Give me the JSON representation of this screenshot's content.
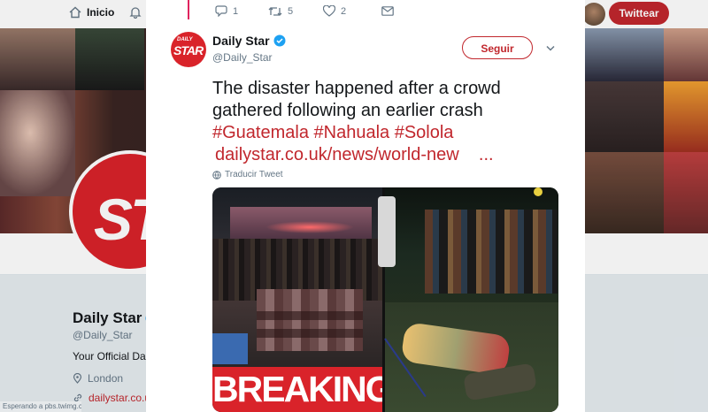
{
  "topbar": {
    "home_label": "Inicio",
    "tweet_button_label": "Twittear"
  },
  "profile": {
    "logo_text": "STAR",
    "name": "Daily Star",
    "handle": "@Daily_Star",
    "bio": "Your Official Daily",
    "location": "London",
    "url": "dailystar.co.uk"
  },
  "status_bar_text": "Esperando a pbs.twimg.com...",
  "tweet": {
    "author_name": "Daily Star",
    "author_handle": "@Daily_Star",
    "avatar_text_top": "DAILY",
    "avatar_text_bottom": "STAR",
    "follow_label": "Seguir",
    "text": "The disaster happened after a crowd gathered following an earlier crash",
    "hashtags": "#Guatemala #Nahuala #Solola",
    "link": "dailystar.co.uk/news/world-new    ...",
    "translate_label": "Traducir Tweet",
    "breaking_label": "BREAKING",
    "actions": {
      "reply_count": "1",
      "retweet_count": "5",
      "like_count": "2"
    }
  },
  "colors": {
    "brand_red": "#c1272d",
    "logo_red": "#d9232a",
    "verified_blue": "#1da1f2",
    "thread_line": "#e0245e"
  },
  "icons": [
    "home-icon",
    "bell-icon",
    "reply-icon",
    "retweet-icon",
    "like-icon",
    "dm-icon",
    "verified-icon",
    "chevron-down-icon",
    "globe-icon",
    "location-icon",
    "link-icon"
  ]
}
